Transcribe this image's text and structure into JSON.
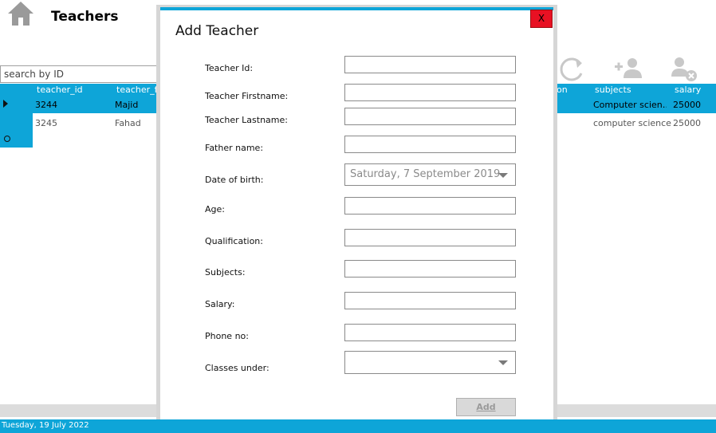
{
  "header": {
    "title": "Teachers",
    "home_icon": "home-icon"
  },
  "search": {
    "placeholder": "search by ID",
    "value": "search by ID"
  },
  "toolbar": {
    "icons": [
      "refresh-icon",
      "add-user-icon",
      "remove-user-icon"
    ]
  },
  "grid": {
    "columns": [
      "teacher_id",
      "teacher_fir",
      "ion",
      "subjects",
      "salary"
    ],
    "rows": [
      {
        "teacher_id": "3244",
        "teacher_firstname": "Majid",
        "subjects": "Computer scien…",
        "salary": "25000",
        "selected": true
      },
      {
        "teacher_id": "3245",
        "teacher_firstname": "Fahad",
        "subjects": "computer science",
        "salary": "25000",
        "selected": false
      }
    ]
  },
  "status": {
    "date": "Tuesday, 19 July 2022"
  },
  "dialog": {
    "title": "Add Teacher",
    "close_label": "X",
    "labels": {
      "teacher_id": "Teacher Id:",
      "first_name": "Teacher Firstname:",
      "last_name": "Teacher Lastname:",
      "father_name": "Father name:",
      "dob": "Date of birth:",
      "age": "Age:",
      "qualification": "Qualification:",
      "subjects": "Subjects:",
      "salary": " Salary:",
      "phone": "Phone no:",
      "classes": "Classes under:"
    },
    "dob_value": "Saturday,  7 September 2019",
    "classes_value": "",
    "add_label": "Add"
  },
  "colors": {
    "accent": "#0ea5d8",
    "close": "#e81123"
  }
}
